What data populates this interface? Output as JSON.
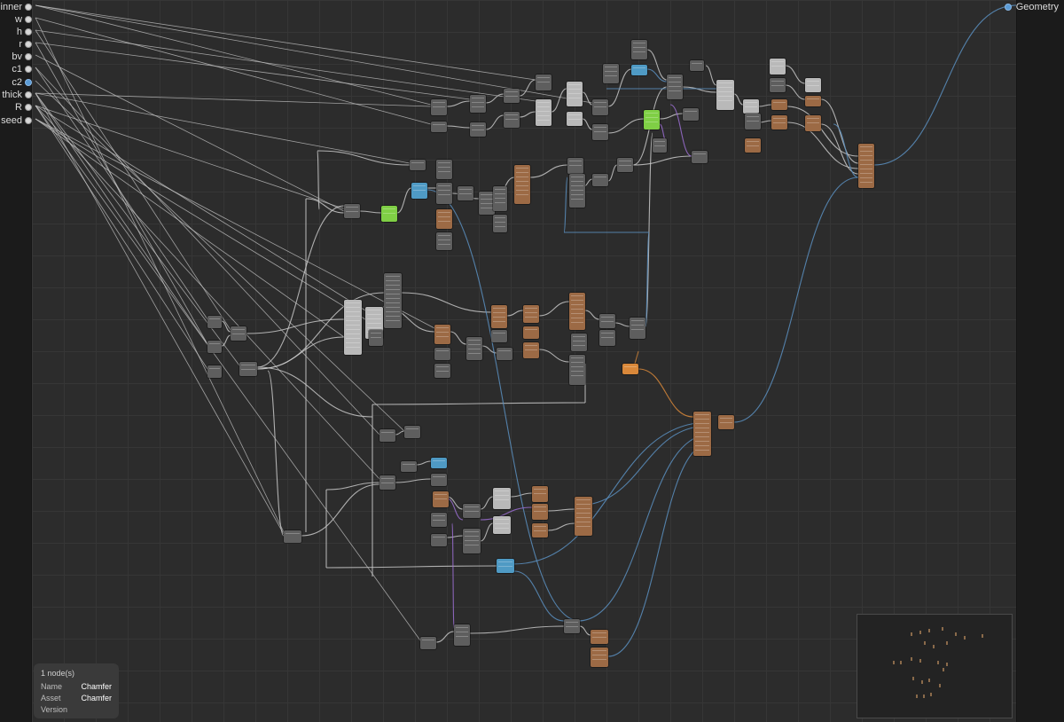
{
  "inputs": [
    {
      "label": "inner",
      "port_color": "#d8d8d8"
    },
    {
      "label": "w",
      "port_color": "#d8d8d8"
    },
    {
      "label": "h",
      "port_color": "#d8d8d8"
    },
    {
      "label": "r",
      "port_color": "#d8d8d8"
    },
    {
      "label": "bv",
      "port_color": "#d8d8d8"
    },
    {
      "label": "c1",
      "port_color": "#d8d8d8"
    },
    {
      "label": "c2",
      "port_color": "#5b9bd5"
    },
    {
      "label": "thick",
      "port_color": "#d8d8d8"
    },
    {
      "label": "R",
      "port_color": "#d8d8d8"
    },
    {
      "label": "seed",
      "port_color": "#d8d8d8"
    }
  ],
  "output": {
    "label": "Geometry",
    "port_color": "#5b9bd5"
  },
  "info_panel": {
    "count": "1 node(s)",
    "rows": [
      {
        "key": "Name",
        "value": "Chamfer"
      },
      {
        "key": "Asset",
        "value": "Chamfer"
      },
      {
        "key": "Version",
        "value": ""
      }
    ]
  },
  "colors": {
    "canvas": "#2c2c2c",
    "wire_float": "#c8c8c8",
    "wire_geometry": "#5b8fc0",
    "wire_vector": "#9b6fd1",
    "wire_field": "#d9883a",
    "node_gray": "#5e5e5e",
    "node_brown": "#9c6a45",
    "node_green": "#7fcf45",
    "node_blue": "#4f9ac4"
  }
}
